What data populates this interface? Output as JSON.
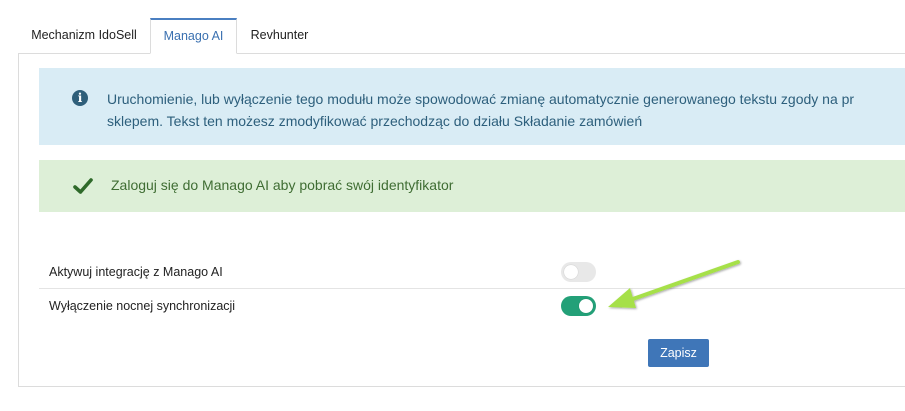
{
  "tabs": [
    {
      "label": "Mechanizm IdoSell",
      "active": false
    },
    {
      "label": "Manago AI",
      "active": true
    },
    {
      "label": "Revhunter",
      "active": false
    }
  ],
  "info_alert": {
    "icon": "info-circle-icon",
    "line1": "Uruchomienie, lub wyłączenie tego modułu może spowodować zmianę automatycznie generowanego tekstu zgody na pr",
    "line2": "sklepem. Tekst ten możesz zmodyfikować przechodząc do działu Składanie zamówień",
    "color": "#d9ecf5"
  },
  "success_alert": {
    "icon": "checkmark-icon",
    "text": "Zaloguj się do Manago AI aby pobrać swój identyfikator",
    "color": "#ddefd7"
  },
  "settings": [
    {
      "label": "Aktywuj integrację z Manago AI",
      "enabled": false
    },
    {
      "label": "Wyłączenie nocnej synchronizacji",
      "enabled": true
    }
  ],
  "save_label": "Zapisz",
  "colors": {
    "accent": "#3f76b8",
    "toggle_on": "#23a078",
    "annotation_arrow": "#a6e04a"
  }
}
